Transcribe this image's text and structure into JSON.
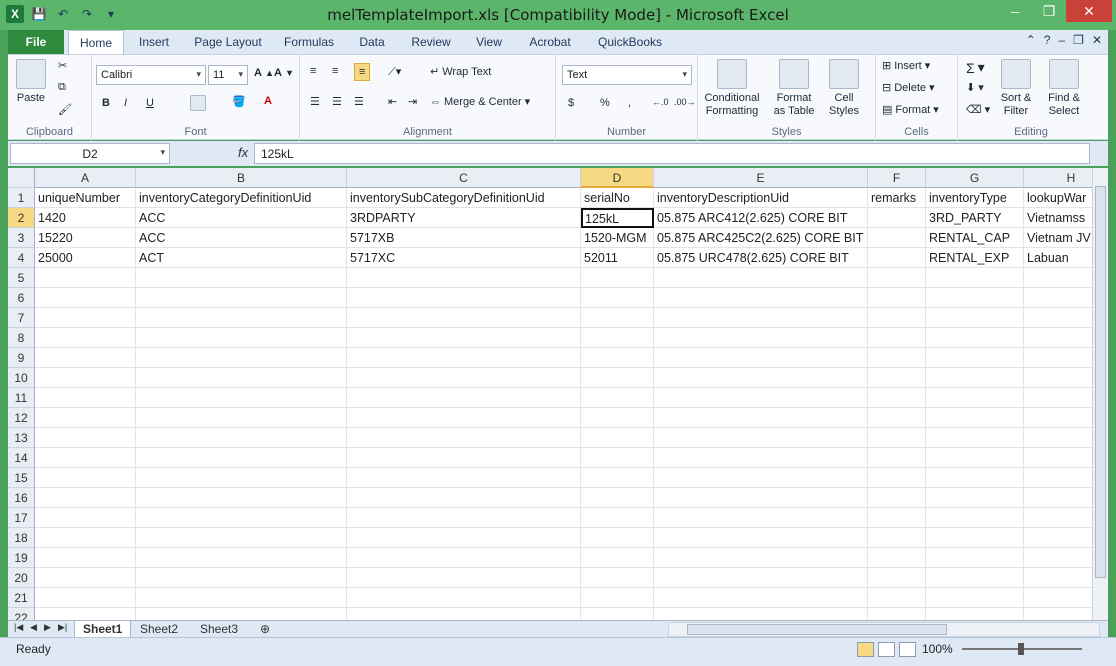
{
  "window": {
    "title": "melTemplateImport.xls  [Compatibility Mode]  -  Microsoft Excel",
    "controls": {
      "minimize": "–",
      "maximize": "❐",
      "close": "✕"
    }
  },
  "ribbon_tabs": [
    "File",
    "Home",
    "Insert",
    "Page Layout",
    "Formulas",
    "Data",
    "Review",
    "View",
    "Acrobat",
    "QuickBooks"
  ],
  "active_tab": "Home",
  "ribbon": {
    "clipboard": {
      "label": "Clipboard",
      "paste": "Paste"
    },
    "font": {
      "label": "Font",
      "family": "Calibri",
      "size": "11",
      "bold": "B",
      "italic": "I",
      "underline": "U"
    },
    "alignment": {
      "label": "Alignment",
      "wrap_text": "Wrap Text",
      "merge_center": "Merge & Center"
    },
    "number": {
      "label": "Number",
      "format": "Text",
      "currency": "$",
      "percent": "%",
      "comma": ","
    },
    "styles": {
      "label": "Styles",
      "conditional": "Conditional Formatting",
      "format_table": "Format as Table",
      "cell_styles": "Cell Styles"
    },
    "cells": {
      "label": "Cells",
      "insert": "Insert",
      "delete": "Delete",
      "format": "Format"
    },
    "editing": {
      "label": "Editing",
      "sort_filter": "Sort & Filter",
      "find_select": "Find & Select"
    }
  },
  "formula_bar": {
    "name_box": "D2",
    "fx": "fx",
    "content": "125kL"
  },
  "columns": [
    "A",
    "B",
    "C",
    "D",
    "E",
    "F",
    "G",
    "H"
  ],
  "rows": [
    [
      "uniqueNumber",
      "inventoryCategoryDefinitionUid",
      "inventorySubCategoryDefinitionUid",
      "serialNo",
      "inventoryDescriptionUid",
      "remarks",
      "inventoryType",
      "lookupWar"
    ],
    [
      "1420",
      "ACC",
      "3RDPARTY",
      "125kL",
      "05.875 ARC412(2.625) CORE BIT",
      "",
      "3RD_PARTY",
      "Vietnamss"
    ],
    [
      "15220",
      "ACC",
      "5717XB",
      "1520-MGM",
      "05.875 ARC425C2(2.625) CORE BIT",
      "",
      "RENTAL_CAP",
      "Vietnam JV"
    ],
    [
      "25000",
      "ACT",
      "5717XC",
      "52011",
      "05.875 URC478(2.625) CORE BIT",
      "",
      "RENTAL_EXP",
      "Labuan"
    ]
  ],
  "row_numbers": [
    "1",
    "2",
    "3",
    "4",
    "5",
    "6",
    "7",
    "8",
    "9",
    "10",
    "11",
    "12",
    "13",
    "14",
    "15",
    "16",
    "17",
    "18",
    "19",
    "20",
    "21",
    "22"
  ],
  "sheet_tabs": [
    "Sheet1",
    "Sheet2",
    "Sheet3"
  ],
  "status": {
    "text": "Ready",
    "zoom": "100%"
  }
}
